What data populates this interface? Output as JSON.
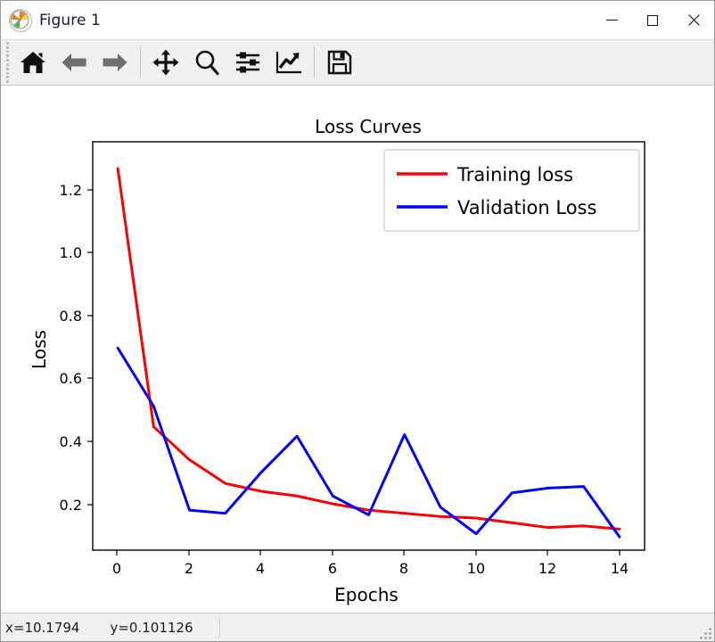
{
  "window": {
    "title": "Figure 1",
    "app_icon": "matplotlib-logo-icon",
    "controls": {
      "minimize": "minimize-button",
      "maximize": "maximize-button",
      "close": "close-button"
    }
  },
  "toolbar": {
    "buttons": [
      {
        "name": "home",
        "tooltip": "Reset original view",
        "icon": "home-icon"
      },
      {
        "name": "back",
        "tooltip": "Back to previous view",
        "icon": "left-arrow-icon"
      },
      {
        "name": "forward",
        "tooltip": "Forward to next view",
        "icon": "right-arrow-icon"
      },
      {
        "name": "pan",
        "tooltip": "Pan axes with left mouse, zoom with right",
        "icon": "move-cross-icon"
      },
      {
        "name": "zoom",
        "tooltip": "Zoom to rectangle",
        "icon": "magnifier-icon"
      },
      {
        "name": "configure-subplots",
        "tooltip": "Configure subplots",
        "icon": "sliders-icon"
      },
      {
        "name": "edit-axis",
        "tooltip": "Edit axis, curve and image parameters",
        "icon": "chart-line-icon"
      },
      {
        "name": "save",
        "tooltip": "Save the figure",
        "icon": "floppy-disk-icon"
      }
    ]
  },
  "statusbar": {
    "x_readout": "x=10.1794",
    "y_readout": "y=0.101126"
  },
  "chart_data": {
    "type": "line",
    "title": "Loss Curves",
    "xlabel": "Epochs",
    "ylabel": "Loss",
    "x": [
      0,
      1,
      2,
      3,
      4,
      5,
      6,
      7,
      8,
      9,
      10,
      11,
      12,
      13,
      14
    ],
    "series": [
      {
        "name": "Training loss",
        "color": "#ff0000",
        "values": [
          1.3,
          0.48,
          0.375,
          0.3,
          0.275,
          0.26,
          0.235,
          0.215,
          0.205,
          0.195,
          0.19,
          0.175,
          0.16,
          0.165,
          0.155
        ]
      },
      {
        "name": "Validation Loss",
        "color": "#0000ff",
        "values": [
          0.73,
          0.545,
          0.215,
          0.205,
          0.335,
          0.45,
          0.26,
          0.2,
          0.455,
          0.225,
          0.14,
          0.27,
          0.285,
          0.29,
          0.13
        ]
      }
    ],
    "xticks": [
      0,
      2,
      4,
      6,
      8,
      10,
      12,
      14
    ],
    "xticklabels": [
      "0",
      "2",
      "4",
      "6",
      "8",
      "10",
      "12",
      "14"
    ],
    "yticks": [
      0.2,
      0.4,
      0.6,
      0.8,
      1.0,
      1.2
    ],
    "yticklabels": [
      "0.2",
      "0.4",
      "0.6",
      "0.8",
      "1.0",
      "1.2"
    ],
    "xlim": [
      -0.7,
      14.7
    ],
    "ylim": [
      0.088,
      1.385
    ],
    "grid": false,
    "legend_position": "upper right",
    "legend_labels": [
      "Training loss",
      "Validation Loss"
    ],
    "facecolor": "#ffffff",
    "linewidth": 3
  }
}
